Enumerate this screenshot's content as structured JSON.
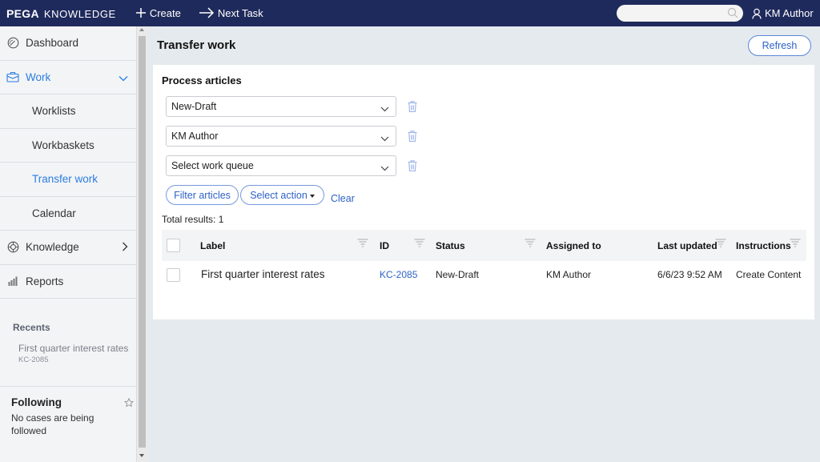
{
  "header": {
    "brand_primary": "PEGA",
    "brand_secondary": "KNOWLEDGE",
    "create_label": "Create",
    "next_task_label": "Next Task",
    "search_placeholder": "",
    "user_name": "KM Author",
    "colors": {
      "bar": "#1f2a5c",
      "accent": "#2b7de1"
    }
  },
  "sidebar": {
    "items": [
      {
        "label": "Dashboard",
        "icon": "dashboard-icon"
      },
      {
        "label": "Work",
        "icon": "briefcase-icon",
        "expanded": true
      },
      {
        "label": "Worklists"
      },
      {
        "label": "Workbaskets"
      },
      {
        "label": "Transfer work",
        "active": true
      },
      {
        "label": "Calendar"
      },
      {
        "label": "Knowledge",
        "icon": "lifebuoy-icon"
      },
      {
        "label": "Reports",
        "icon": "bar-chart-icon"
      }
    ],
    "recents": {
      "title": "Recents",
      "items": [
        {
          "title": "First quarter interest rates",
          "id": "KC-2085"
        }
      ]
    },
    "following": {
      "title": "Following",
      "empty_text": "No cases are being followed"
    }
  },
  "main": {
    "title": "Transfer work",
    "refresh_label": "Refresh",
    "section_title": "Process articles",
    "filters": [
      {
        "value": "New-Draft"
      },
      {
        "value": "KM Author"
      },
      {
        "value": "Select work queue"
      }
    ],
    "filter_button": "Filter articles",
    "action_button": "Select action",
    "clear_label": "Clear",
    "total_results": "Total results: 1",
    "table": {
      "columns": [
        "Label",
        "ID",
        "Status",
        "Assigned to",
        "Last updated",
        "Instructions"
      ],
      "rows": [
        {
          "label": "First quarter interest rates",
          "id": "KC-2085",
          "status": "New-Draft",
          "assigned_to": "KM Author",
          "last_updated": "6/6/23 9:52 AM",
          "instructions": "Create Content"
        }
      ]
    }
  }
}
